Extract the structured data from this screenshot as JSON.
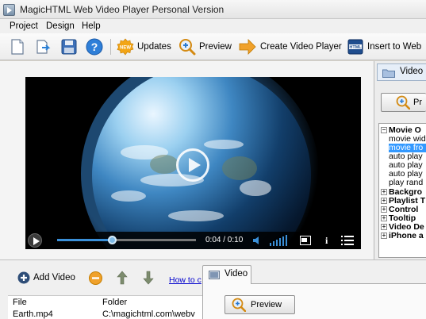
{
  "window": {
    "title": "MagicHTML Web Video Player Personal Version"
  },
  "menu": {
    "items": [
      "Project",
      "Design",
      "Help"
    ]
  },
  "toolbar": {
    "updates_label": "Updates",
    "preview_label": "Preview",
    "create_label": "Create Video Player",
    "insert_label": "Insert to Web"
  },
  "player": {
    "time": "0:04 / 0:10",
    "progress_fraction": 0.4
  },
  "list_toolbar": {
    "add_video_label": "Add Video",
    "howto_label": "How to c"
  },
  "file_list": {
    "columns": [
      "File",
      "Folder"
    ],
    "rows": [
      {
        "file": "Earth.mp4",
        "folder": "C:\\magichtml.com\\webv"
      }
    ]
  },
  "video_tab": {
    "label": "Video",
    "preview_label": "Preview"
  },
  "right_panel": {
    "tab_label": "Video P",
    "preview_label": "Pr",
    "tree": {
      "movie_group": "Movie O",
      "movie_items": [
        "movie wid",
        "movie fro",
        "auto play",
        "auto play",
        "auto play",
        "play rand"
      ],
      "selected_index": 1,
      "groups": [
        "Backgro",
        "Playlist T",
        "Control",
        "Tooltip",
        "Video De",
        "iPhone a"
      ]
    }
  },
  "colors": {
    "selection": "#3399ff",
    "player_progress": "#3a8fd8",
    "link": "#0000cc"
  }
}
